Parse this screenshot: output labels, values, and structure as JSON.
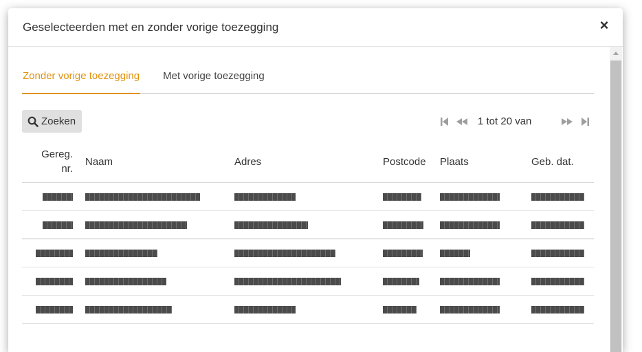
{
  "dialog": {
    "title": "Geselecteerden met en zonder vorige toezegging",
    "close_label": "×",
    "close_icon": "close-icon"
  },
  "tabs": [
    {
      "label": "Zonder vorige toezegging",
      "active": true
    },
    {
      "label": "Met vorige toezegging",
      "active": false
    }
  ],
  "toolbar": {
    "search_label": "Zoeken",
    "search_icon": "search-icon"
  },
  "pagination": {
    "range_text": "1 tot 20 van",
    "first_icon": "first-page-icon",
    "previous_icon": "previous-page-icon",
    "next_icon": "next-page-icon",
    "last_icon": "last-page-icon"
  },
  "table": {
    "columns": [
      "Gereg. nr.",
      "Naam",
      "Adres",
      "Postcode",
      "Plaats",
      "Geb. dat."
    ]
  },
  "colors": {
    "accent": "#e0920c",
    "redaction": "#4b4b4b"
  }
}
